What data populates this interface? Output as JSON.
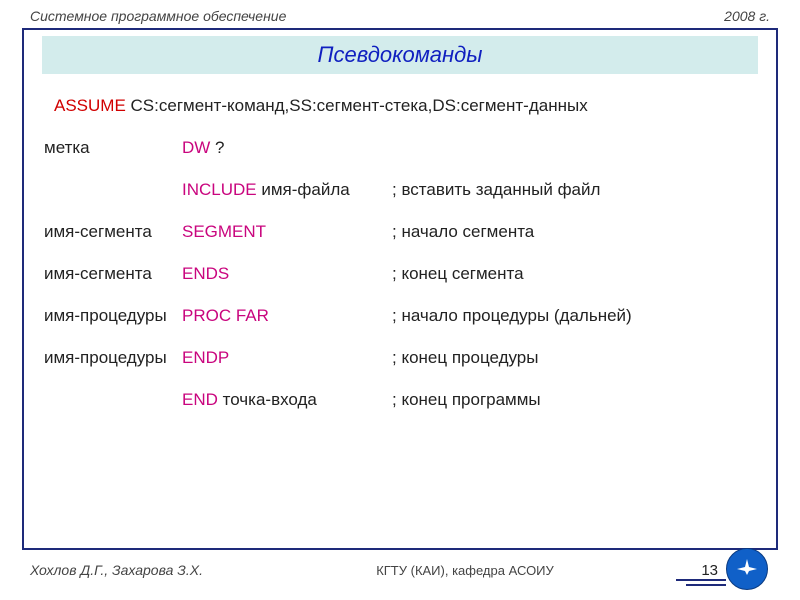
{
  "header": {
    "left": "Системное программное обеспечение",
    "right": "2008 г."
  },
  "title": "Псевдокоманды",
  "assume": {
    "kw": "ASSUME",
    "cs_label": "CS:",
    "cs_val": "сегмент-команд",
    "ss_label": ",SS:",
    "ss_val": "сегмент-стека",
    "ds_label": ",DS:",
    "ds_val": "сегмент-данных"
  },
  "rows": [
    {
      "c1": "метка",
      "c2kw": "DW",
      "c2txt": "  ?",
      "c3": ""
    },
    {
      "c1": "",
      "c2kw": "INCLUDE",
      "c2txt": "  имя-файла",
      "c3": "; вставить заданный файл"
    },
    {
      "c1": "имя-сегмента",
      "c2kw": "SEGMENT",
      "c2txt": "",
      "c3": "; начало сегмента"
    },
    {
      "c1": "имя-сегмента",
      "c2kw": "ENDS",
      "c2txt": "",
      "c3": "; конец  сегмента"
    },
    {
      "c1": "имя-процедуры",
      "c2kw": "PROC   FAR",
      "c2txt": "",
      "c3": "; начало процедуры (дальней)"
    },
    {
      "c1": "имя-процедуры",
      "c2kw": "ENDP",
      "c2txt": "",
      "c3": "; конец  процедуры"
    },
    {
      "c1": "",
      "c2kw": "END",
      "c2txt": "  точка-входа",
      "c3": "; конец  программы"
    }
  ],
  "footer": {
    "left": "Хохлов Д.Г., Захарова З.Х.",
    "center": "КГТУ  (КАИ),   кафедра АСОИУ",
    "page": "13"
  }
}
